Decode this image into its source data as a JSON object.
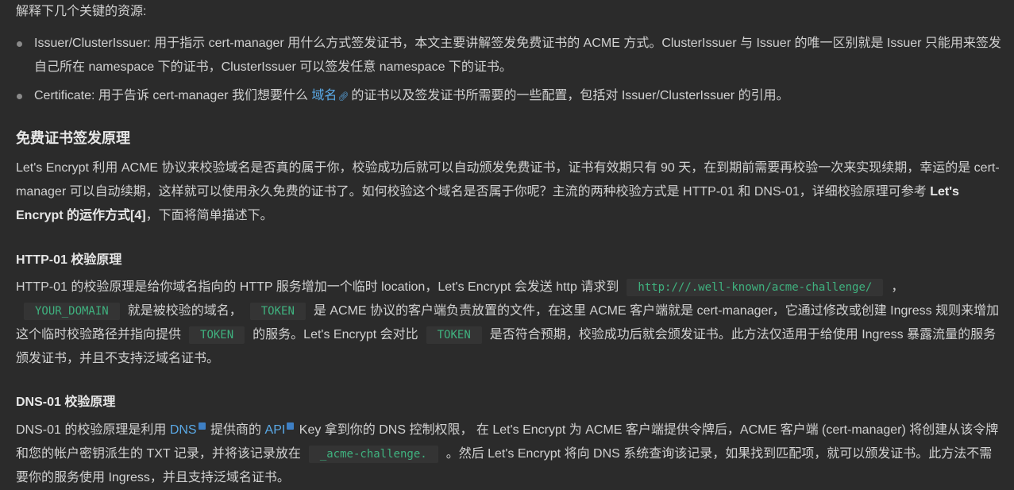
{
  "intro": "解释下几个关键的资源:",
  "bullets": {
    "b1": "Issuer/ClusterIssuer: 用于指示 cert-manager 用什么方式签发证书，本文主要讲解签发免费证书的 ACME 方式。ClusterIssuer 与 Issuer 的唯一区别就是 Issuer 只能用来签发自己所在 namespace 下的证书，ClusterIssuer 可以签发任意 namespace 下的证书。",
    "b2_a": "Certificate: 用于告诉 cert-manager 我们想要什么",
    "b2_link": "域名",
    "b2_b": "的证书以及签发证书所需要的一些配置，包括对 Issuer/ClusterIssuer 的引用。"
  },
  "section1": {
    "title": "免费证书签发原理",
    "p_a": "Let's Encrypt 利用 ACME 协议来校验域名是否真的属于你，校验成功后就可以自动颁发免费证书，证书有效期只有 90 天，在到期前需要再校验一次来实现续期，幸运的是 cert-manager 可以自动续期，这样就可以使用永久免费的证书了。如何校验这个域名是否属于你呢？主流的两种校验方式是 HTTP-01 和 DNS-01，详细校验原理可参考",
    "p_bold": "Let's Encrypt 的运作方式[4]",
    "p_b": "，下面将简单描述下。"
  },
  "http01": {
    "title": "HTTP-01 校验原理",
    "t1": "HTTP-01 的校验原理是给你域名指向的 HTTP 服务增加一个临时 location，Let's Encrypt 会发送 http 请求到",
    "c1": "http:///.well-known/acme-challenge/",
    "t2": "，",
    "c2": "YOUR_DOMAIN",
    "t3": "就是被校验的域名，",
    "c3": "TOKEN",
    "t4": "是 ACME 协议的客户端负责放置的文件，在这里 ACME 客户端就是 cert-manager，它通过修改或创建 Ingress 规则来增加这个临时校验路径并指向提供",
    "c4": "TOKEN",
    "t5": "的服务。Let's Encrypt 会对比",
    "c5": "TOKEN",
    "t6": "是否符合预期，校验成功后就会颁发证书。此方法仅适用于给使用 Ingress 暴露流量的服务颁发证书，并且不支持泛域名证书。"
  },
  "dns01": {
    "title": "DNS-01 校验原理",
    "t1": "DNS-01 的校验原理是利用",
    "link1": "DNS",
    "t2": "提供商的",
    "link2": "API",
    "t3": "Key 拿到你的 DNS 控制权限， 在 Let's Encrypt 为 ACME 客户端提供令牌后，ACME 客户端 (cert-manager) 将创建从该令牌和您的帐户密钥派生的 TXT 记录，并将该记录放在",
    "c1": "_acme-challenge.",
    "t4": "。然后 Let's Encrypt 将向 DNS 系统查询该记录，如果找到匹配项，就可以颁发证书。此方法不需要你的服务使用 Ingress，并且支持泛域名证书。"
  },
  "icons": {
    "external_link": "link-icon",
    "blue_badge": "book-icon"
  },
  "colors": {
    "background": "#2b2b2b",
    "text": "#d1d1d1",
    "link": "#5aa9e6",
    "code": "#3fb27f"
  }
}
